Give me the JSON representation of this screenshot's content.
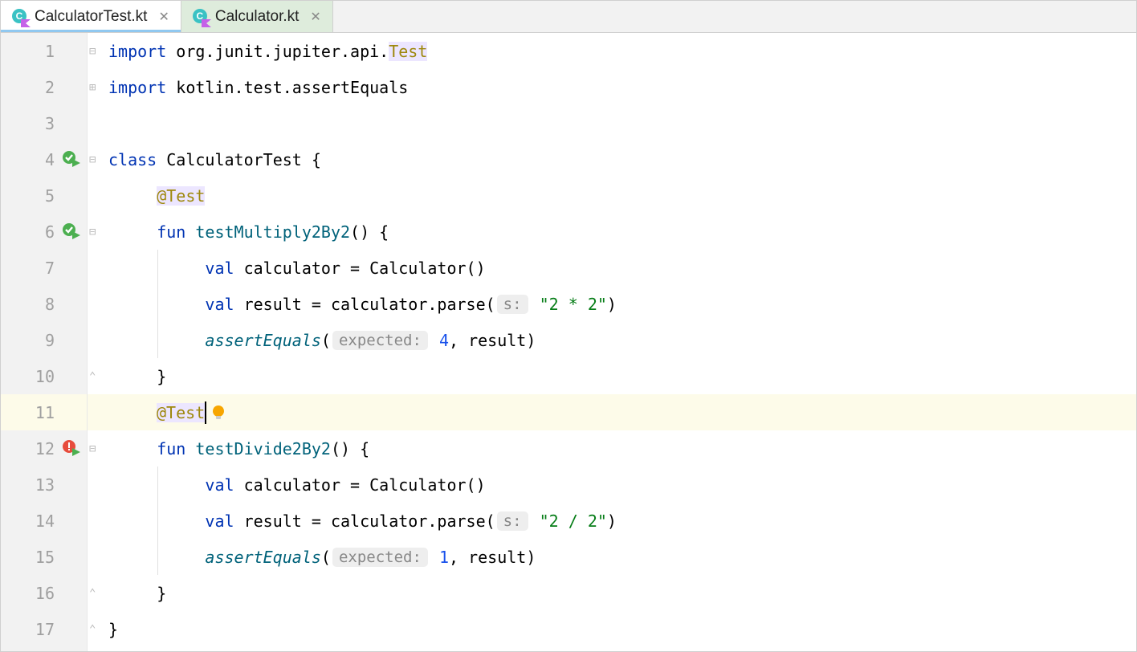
{
  "tabs": [
    {
      "label": "CalculatorTest.kt",
      "active": true
    },
    {
      "label": "Calculator.kt",
      "active": false
    }
  ],
  "lines": {
    "l1": "1",
    "l2": "2",
    "l3": "3",
    "l4": "4",
    "l5": "5",
    "l6": "6",
    "l7": "7",
    "l8": "8",
    "l9": "9",
    "l10": "10",
    "l11": "11",
    "l12": "12",
    "l13": "13",
    "l14": "14",
    "l15": "15",
    "l16": "16",
    "l17": "17"
  },
  "code": {
    "import_kw": "import",
    "import1_pkg": "org.junit.jupiter.api.",
    "import1_last": "Test",
    "import2": "kotlin.test.assertEquals",
    "class_kw": "class",
    "class_name": "CalculatorTest",
    "test_ann": "@Test",
    "fun_kw": "fun",
    "fn1_name": "testMultiply2By2",
    "fn2_name": "testDivide2By2",
    "val_kw": "val",
    "calc_decl": "calculator = Calculator()",
    "result_lhs": "result = calculator.parse(",
    "hint_s": "s:",
    "str1": "\"2 * 2\"",
    "str2": "\"2 / 2\"",
    "assert_fn": "assertEquals",
    "hint_exp": "expected:",
    "num4": "4",
    "num1": "1",
    "result_tail": ", result)",
    "brace_open": "{",
    "brace_close": "}",
    "paren_open": "(",
    "paren_close": ")",
    "paren_close_brace": "() {"
  }
}
